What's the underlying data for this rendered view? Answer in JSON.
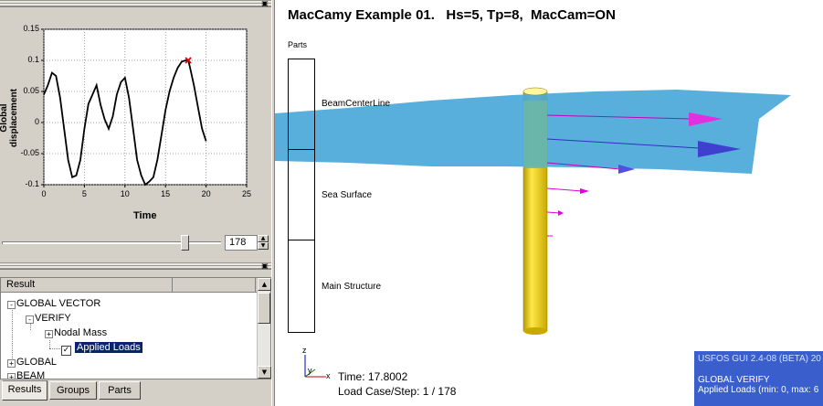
{
  "left_panel": {
    "plot": {
      "ylabel": "Global displacement",
      "xlabel": "Time",
      "y_ticks": [
        "0.15",
        "0.1",
        "0.05",
        "0",
        "-0.05",
        "-0.1"
      ],
      "x_ticks": [
        "0",
        "5",
        "10",
        "15",
        "20",
        "25"
      ]
    },
    "slider": {
      "value": "178",
      "position": 0.85
    },
    "tree": {
      "header": "Result",
      "rows": [
        {
          "label": "GLOBAL VECTOR",
          "expander": "-"
        },
        {
          "label": "VERIFY",
          "expander": "-"
        },
        {
          "label": "Nodal Mass",
          "expander": "+"
        },
        {
          "label": "Applied Loads",
          "checked": true,
          "selected": true
        },
        {
          "label": "GLOBAL",
          "expander": "+"
        },
        {
          "label": "BEAM",
          "expander": "+"
        }
      ]
    },
    "tabs": [
      "Results",
      "Groups",
      "Parts"
    ]
  },
  "viewport": {
    "title": "MacCamy Example 01.   Hs=5, Tp=8,  MacCam=ON",
    "legend": {
      "title": "Parts",
      "items": [
        {
          "label": "BeamCenterLine",
          "color": "#000000"
        },
        {
          "label": "Sea Surface",
          "color": "#00a8f0"
        },
        {
          "label": "Main Structure",
          "color": "#ffd200"
        }
      ]
    },
    "axes": {
      "z": "z",
      "y": "y",
      "x": "x"
    },
    "time_text": "Time: 17.8002",
    "step_text": "Load Case/Step: 1 / 178",
    "status": {
      "line1": "USFOS GUI 2.4-08 (BETA) 20",
      "line2": "GLOBAL VERIFY",
      "line3": "Applied Loads (min: 0, max: 6"
    }
  },
  "chart_data": {
    "type": "line",
    "title": "",
    "xlabel": "Time",
    "ylabel": "Global displacement",
    "xlim": [
      0,
      25
    ],
    "ylim": [
      -0.1,
      0.15
    ],
    "grid": true,
    "series": [
      {
        "x": [
          0,
          0.5,
          1,
          1.5,
          2,
          2.5,
          3,
          3.5,
          4,
          4.5,
          5,
          5.5,
          6,
          6.5,
          7,
          7.5,
          8,
          8.5,
          9,
          9.5,
          10,
          10.5,
          11,
          11.5,
          12,
          12.5,
          13,
          13.5,
          14,
          14.5,
          15,
          15.5,
          16,
          16.5,
          17,
          17.5,
          17.8,
          18,
          18.5,
          19,
          19.5,
          20
        ],
        "y": [
          0.045,
          0.06,
          0.08,
          0.075,
          0.04,
          -0.01,
          -0.06,
          -0.088,
          -0.085,
          -0.06,
          -0.01,
          0.03,
          0.045,
          0.06,
          0.028,
          0.005,
          -0.01,
          0.01,
          0.045,
          0.065,
          0.072,
          0.04,
          -0.01,
          -0.06,
          -0.085,
          -0.1,
          -0.095,
          -0.088,
          -0.06,
          -0.02,
          0.02,
          0.05,
          0.072,
          0.088,
          0.098,
          0.1,
          0.1,
          0.09,
          0.06,
          0.025,
          -0.01,
          -0.03
        ]
      }
    ],
    "marker": {
      "x": 17.8,
      "y": 0.1
    }
  }
}
